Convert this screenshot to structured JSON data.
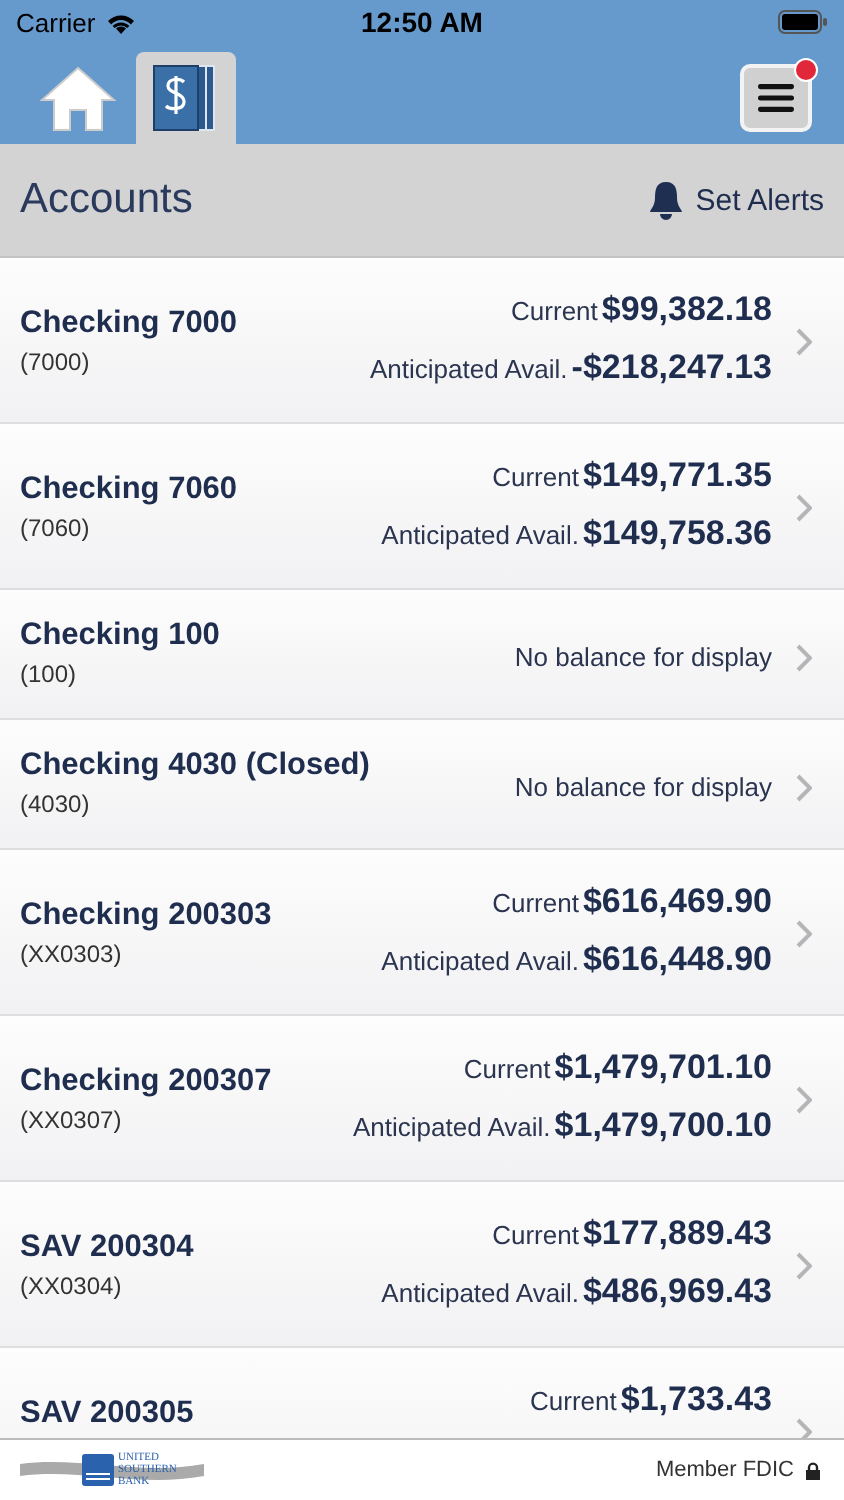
{
  "status_bar": {
    "carrier": "Carrier",
    "time": "12:50 AM"
  },
  "nav_tabs": [
    {
      "kind": "home",
      "selected": false
    },
    {
      "kind": "accounts",
      "selected": true
    }
  ],
  "menu": {
    "notification": true
  },
  "header": {
    "title": "Accounts",
    "alerts_label": "Set Alerts"
  },
  "accounts": [
    {
      "kind": "balances",
      "name": "Checking 7000",
      "number": "(7000)",
      "current_label": "Current",
      "current": "$99,382.18",
      "anticipated_label": "Anticipated Avail.",
      "anticipated": "-$218,247.13"
    },
    {
      "kind": "balances",
      "name": "Checking 7060",
      "number": "(7060)",
      "current_label": "Current",
      "current": "$149,771.35",
      "anticipated_label": "Anticipated Avail.",
      "anticipated": "$149,758.36"
    },
    {
      "kind": "no_balance",
      "name": "Checking 100",
      "number": "(100)",
      "message": "No balance for display"
    },
    {
      "kind": "no_balance",
      "name": "Checking 4030 (Closed)",
      "number": "(4030)",
      "message": "No balance for display"
    },
    {
      "kind": "balances",
      "name": "Checking 200303",
      "number": "(XX0303)",
      "current_label": "Current",
      "current": "$616,469.90",
      "anticipated_label": "Anticipated Avail.",
      "anticipated": "$616,448.90"
    },
    {
      "kind": "balances",
      "name": "Checking 200307",
      "number": "(XX0307)",
      "current_label": "Current",
      "current": "$1,479,701.10",
      "anticipated_label": "Anticipated Avail.",
      "anticipated": "$1,479,700.10"
    },
    {
      "kind": "balances",
      "name": "SAV 200304",
      "number": "(XX0304)",
      "current_label": "Current",
      "current": "$177,889.43",
      "anticipated_label": "Anticipated Avail.",
      "anticipated": "$486,969.43"
    },
    {
      "kind": "balances",
      "name": "SAV 200305",
      "current_label": "Current",
      "current": "$1,733.43"
    }
  ],
  "footer": {
    "bank_name": [
      "UNITED",
      "SOUTHERN",
      "BANK"
    ],
    "member": "Member FDIC"
  }
}
